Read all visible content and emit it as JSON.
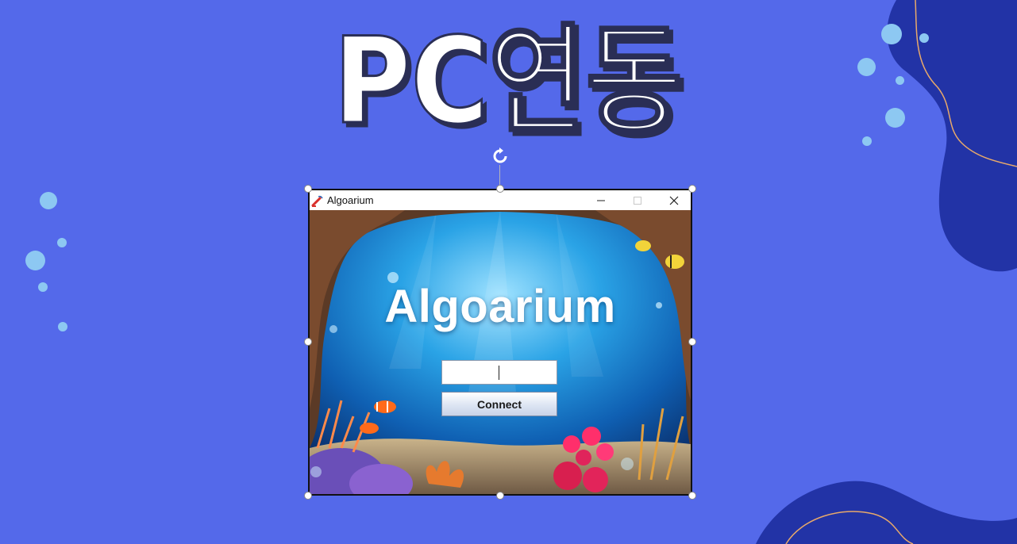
{
  "slide": {
    "title": "PC연동",
    "colors": {
      "background": "#5469ea",
      "blob": "#2233a6",
      "blob_line": "#e8a96a",
      "bubble": "#8dc8f2"
    }
  },
  "selection": {
    "rotate_icon": "rotate-icon",
    "handle_icon": "resize-handle-icon"
  },
  "app": {
    "window_title": "Algoarium",
    "icon": "java-cup-icon",
    "heading": "Algoarium",
    "input_value": "",
    "connect_label": "Connect",
    "controls": {
      "minimize_icon": "minimize-icon",
      "maximize_icon": "maximize-icon",
      "close_icon": "close-icon"
    }
  }
}
